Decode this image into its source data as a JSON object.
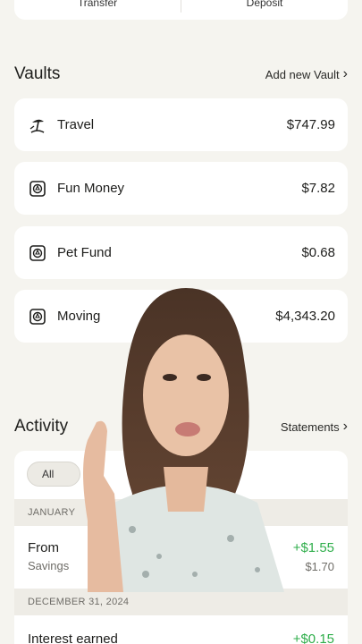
{
  "top_actions": {
    "transfer": "Transfer",
    "deposit": "Deposit"
  },
  "vaults": {
    "title": "Vaults",
    "add_link": "Add new Vault",
    "items": [
      {
        "name": "Travel",
        "amount": "$747.99",
        "icon": "beach-icon"
      },
      {
        "name": "Fun Money",
        "amount": "$7.82",
        "icon": "vault-lock-icon"
      },
      {
        "name": "Pet Fund",
        "amount": "$0.68",
        "icon": "vault-lock-icon"
      },
      {
        "name": "Moving",
        "amount": "$4,343.20",
        "icon": "vault-lock-icon"
      }
    ]
  },
  "activity": {
    "title": "Activity",
    "link": "Statements",
    "filter": "All",
    "groups": [
      {
        "date": "JANUARY",
        "txn": {
          "title": "From",
          "sub": "Savings",
          "amount": "+$1.55",
          "balance": "$1.70"
        }
      },
      {
        "date": "DECEMBER 31, 2024",
        "txn": {
          "title": "Interest earned",
          "sub": "",
          "amount": "+$0.15",
          "balance": ""
        }
      }
    ]
  },
  "colors": {
    "background": "#f5f4ef",
    "card": "#ffffff",
    "positive": "#2fae4b"
  }
}
